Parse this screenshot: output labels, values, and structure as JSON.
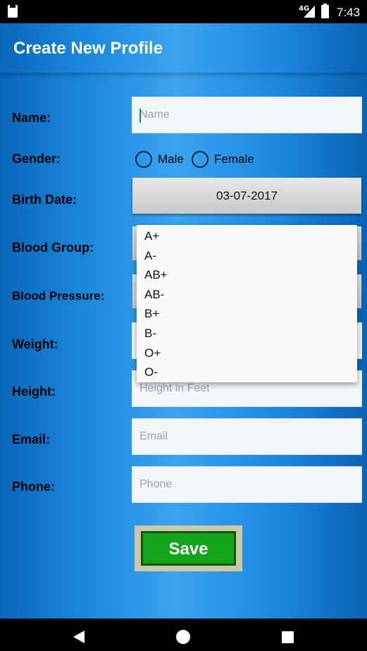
{
  "status_bar": {
    "network": "4G",
    "time": "7:43"
  },
  "app_bar": {
    "title": "Create New Profile"
  },
  "form": {
    "name": {
      "label": "Name:",
      "placeholder": "Name"
    },
    "gender": {
      "label": "Gender:",
      "options": [
        "Male",
        "Female"
      ]
    },
    "birth_date": {
      "label": "Birth Date:",
      "value": "03-07-2017"
    },
    "blood_group": {
      "label": "Blood Group:"
    },
    "blood_pressure": {
      "label": "Blood Pressure:"
    },
    "weight": {
      "label": "Weight:"
    },
    "height": {
      "label": "Height:",
      "placeholder": "Height in Feet"
    },
    "email": {
      "label": "Email:",
      "placeholder": "Email"
    },
    "phone": {
      "label": "Phone:",
      "placeholder": "Phone"
    }
  },
  "blood_group_dropdown": {
    "options": [
      "A+",
      "A-",
      "AB+",
      "AB-",
      "B+",
      "B-",
      "O+",
      "O-"
    ]
  },
  "save_button": {
    "label": "Save"
  },
  "colors": {
    "accent_blue": "#1a86db",
    "save_green": "#14a31a"
  }
}
